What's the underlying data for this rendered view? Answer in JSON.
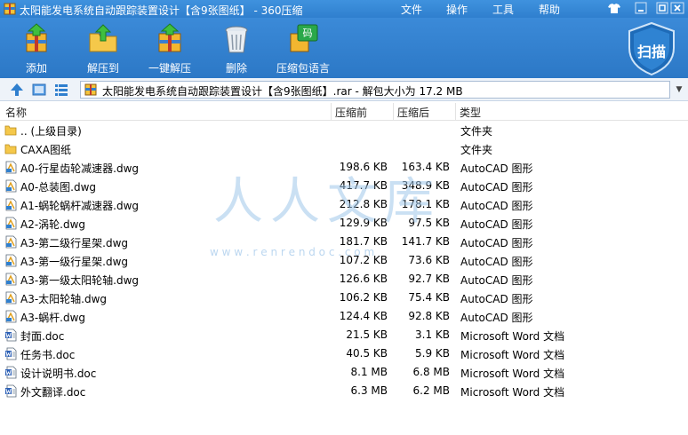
{
  "window": {
    "title": "太阳能发电系统自动跟踪装置设计【含9张图纸】 - 360压缩",
    "menus": [
      "文件",
      "操作",
      "工具",
      "帮助"
    ],
    "colors": {
      "titlebar": "#2f7fce",
      "toolbar": "#3b8ad8",
      "accent": "#1e6bb8"
    }
  },
  "toolbar": {
    "add": "添加",
    "extract": "解压到",
    "oneclick": "一键解压",
    "delete": "删除",
    "language": "压缩包语言",
    "scan": "扫描"
  },
  "addressbar": {
    "path": "太阳能发电系统自动跟踪装置设计【含9张图纸】.rar - 解包大小为 17.2 MB"
  },
  "columns": {
    "name": "名称",
    "size": "压缩前",
    "compressed": "压缩后",
    "type": "类型"
  },
  "files": [
    {
      "name": ".. (上级目录)",
      "size": "",
      "compressed": "",
      "type": "文件夹",
      "icon": "folder"
    },
    {
      "name": "CAXA图纸",
      "size": "",
      "compressed": "",
      "type": "文件夹",
      "icon": "folder"
    },
    {
      "name": "A0-行星齿轮减速器.dwg",
      "size": "198.6 KB",
      "compressed": "163.4 KB",
      "type": "AutoCAD 图形",
      "icon": "dwg"
    },
    {
      "name": "A0-总装图.dwg",
      "size": "417.7 KB",
      "compressed": "348.9 KB",
      "type": "AutoCAD 图形",
      "icon": "dwg"
    },
    {
      "name": "A1-蜗轮蜗杆减速器.dwg",
      "size": "212.8 KB",
      "compressed": "178.1 KB",
      "type": "AutoCAD 图形",
      "icon": "dwg"
    },
    {
      "name": "A2-涡轮.dwg",
      "size": "129.9 KB",
      "compressed": "97.5 KB",
      "type": "AutoCAD 图形",
      "icon": "dwg"
    },
    {
      "name": "A3-第二级行星架.dwg",
      "size": "181.7 KB",
      "compressed": "141.7 KB",
      "type": "AutoCAD 图形",
      "icon": "dwg"
    },
    {
      "name": "A3-第一级行星架.dwg",
      "size": "107.2 KB",
      "compressed": "73.6 KB",
      "type": "AutoCAD 图形",
      "icon": "dwg"
    },
    {
      "name": "A3-第一级太阳轮轴.dwg",
      "size": "126.6 KB",
      "compressed": "92.7 KB",
      "type": "AutoCAD 图形",
      "icon": "dwg"
    },
    {
      "name": "A3-太阳轮轴.dwg",
      "size": "106.2 KB",
      "compressed": "75.4 KB",
      "type": "AutoCAD 图形",
      "icon": "dwg"
    },
    {
      "name": "A3-蜗杆.dwg",
      "size": "124.4 KB",
      "compressed": "92.8 KB",
      "type": "AutoCAD 图形",
      "icon": "dwg"
    },
    {
      "name": "封面.doc",
      "size": "21.5 KB",
      "compressed": "3.1 KB",
      "type": "Microsoft Word 文档",
      "icon": "doc"
    },
    {
      "name": "任务书.doc",
      "size": "40.5 KB",
      "compressed": "5.9 KB",
      "type": "Microsoft Word 文档",
      "icon": "doc"
    },
    {
      "name": "设计说明书.doc",
      "size": "8.1 MB",
      "compressed": "6.8 MB",
      "type": "Microsoft Word 文档",
      "icon": "doc"
    },
    {
      "name": "外文翻译.doc",
      "size": "6.3 MB",
      "compressed": "6.2 MB",
      "type": "Microsoft Word 文档",
      "icon": "doc"
    }
  ],
  "watermark": {
    "text": "人人文库",
    "url": "w w w . r e n r e n d o c . c o m"
  }
}
